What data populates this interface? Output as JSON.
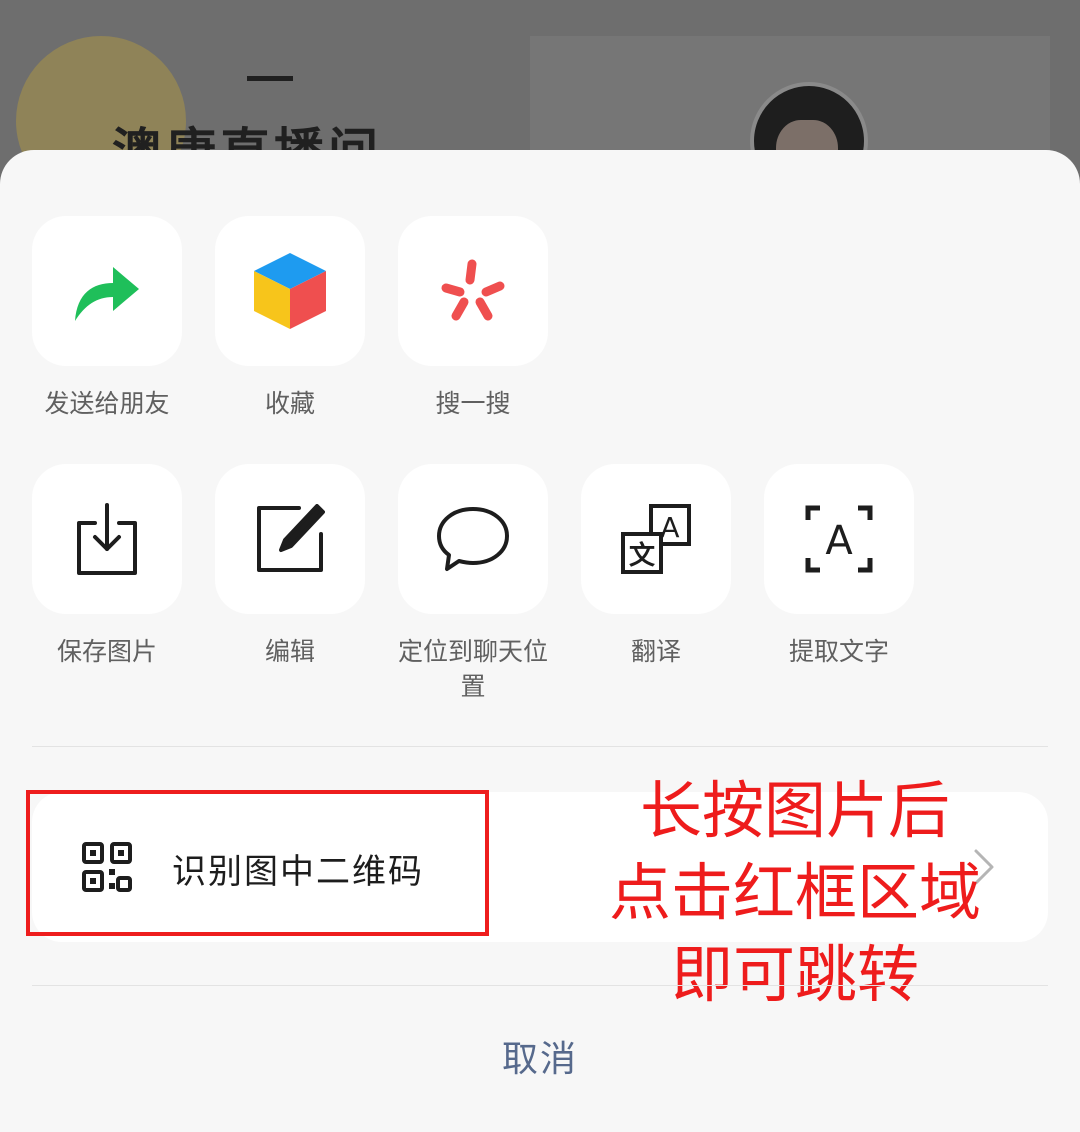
{
  "background": {
    "dash": "—",
    "title": "澳康直播间"
  },
  "sheet": {
    "row1": [
      {
        "label": "发送给朋友",
        "icon": "share-arrow-icon"
      },
      {
        "label": "收藏",
        "icon": "favorite-cube-icon"
      },
      {
        "label": "搜一搜",
        "icon": "search-spark-icon"
      }
    ],
    "row2": [
      {
        "label": "保存图片",
        "icon": "save-download-icon"
      },
      {
        "label": "编辑",
        "icon": "edit-icon"
      },
      {
        "label": "定位到聊天位置",
        "icon": "chat-bubble-icon"
      },
      {
        "label": "翻译",
        "icon": "translate-icon"
      },
      {
        "label": "提取文字",
        "icon": "extract-text-icon"
      }
    ],
    "qr": {
      "label": "识别图中二维码",
      "icon": "qr-code-icon"
    },
    "cancel": "取消"
  },
  "annotation": {
    "line1": "长按图片后",
    "line2": "点击红框区域",
    "line3": "即可跳转"
  },
  "colors": {
    "share_green": "#1fbf5a",
    "annotation_red": "#ee1c1c",
    "cancel_blue": "#56698c"
  }
}
